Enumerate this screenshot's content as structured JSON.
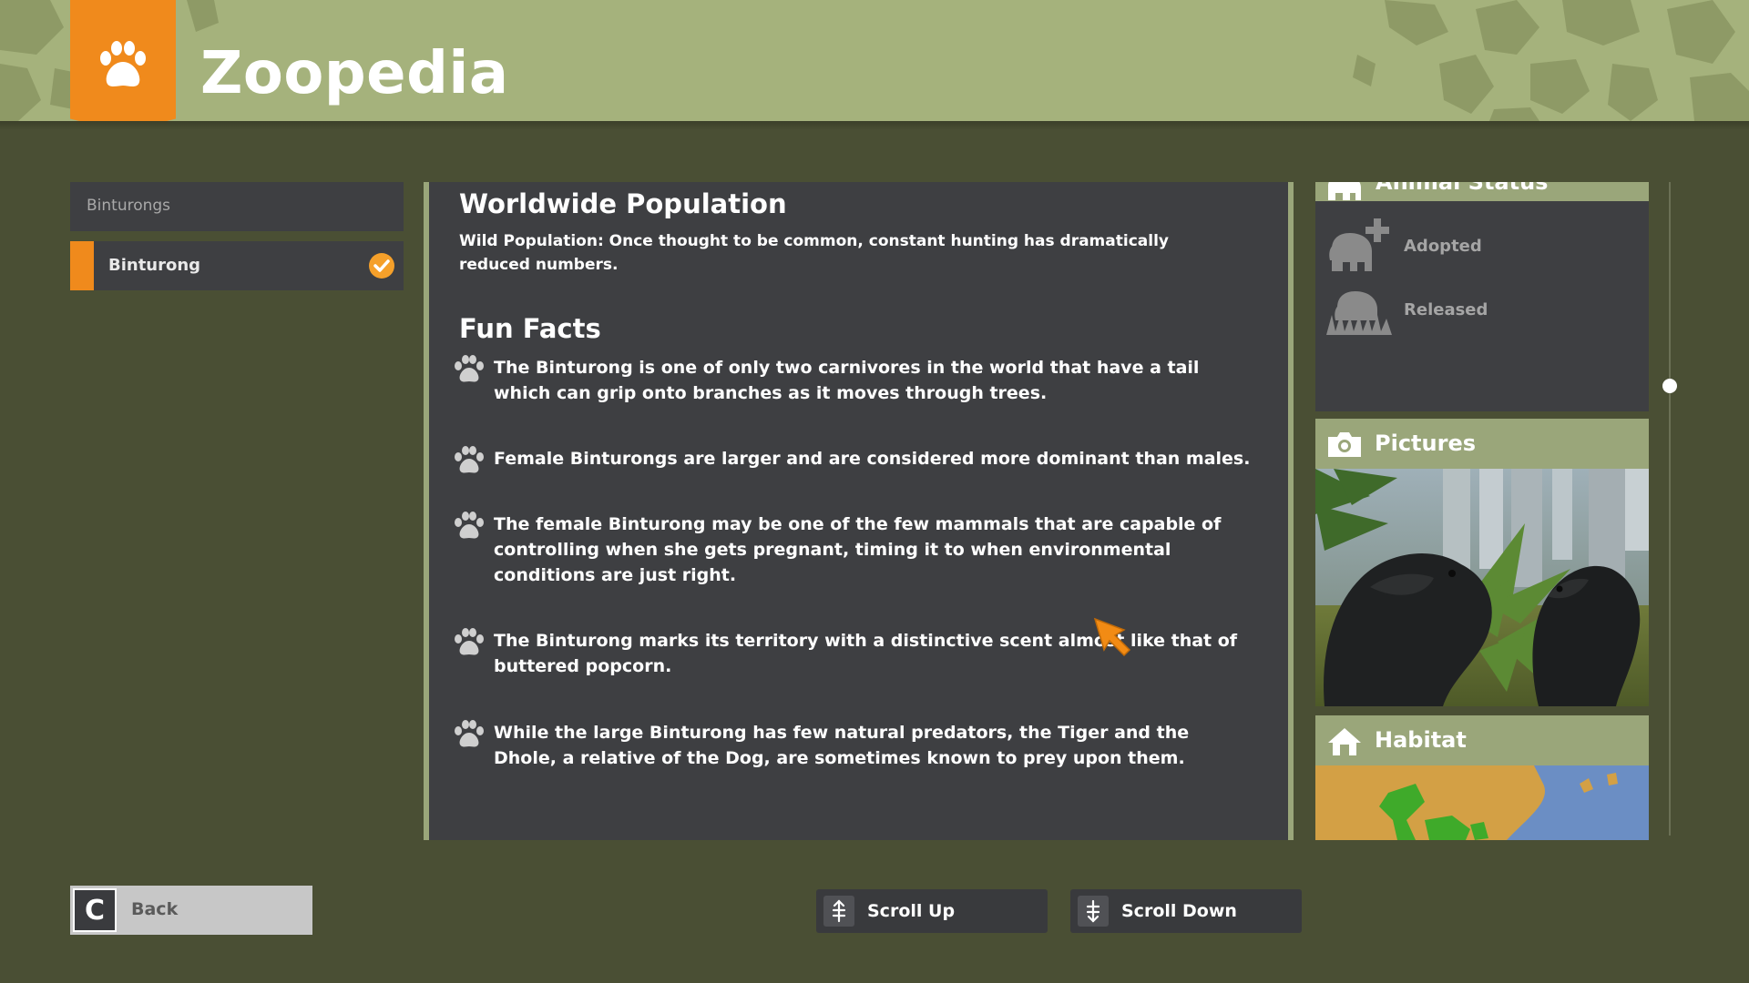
{
  "app": {
    "title": "Zoopedia"
  },
  "sidebar": {
    "category": "Binturongs",
    "items": [
      {
        "label": "Binturong",
        "checked": true
      }
    ]
  },
  "content": {
    "population": {
      "title": "Worldwide Population",
      "text": "Wild Population: Once thought to be common, constant hunting has dramatically reduced numbers."
    },
    "fun_facts": {
      "title": "Fun Facts",
      "items": [
        "The Binturong is one of only two carnivores in the world that have a tail which can grip onto branches as it moves through trees.",
        "Female Binturongs are larger and are considered more dominant than males.",
        "The female Binturong may be one of the few mammals that are capable of controlling when she gets pregnant, timing it to when environmental conditions are just right.",
        "The Binturong marks its territory with a distinctive scent almost like that of buttered popcorn.",
        "While the large Binturong has few natural predators, the Tiger and the Dhole, a relative of the Dog, are sometimes known to prey upon them."
      ]
    }
  },
  "right_panel": {
    "status": {
      "title": "Animal Status",
      "rows": [
        {
          "label": "Adopted",
          "icon": "elephant-plus-icon"
        },
        {
          "label": "Released",
          "icon": "elephant-grass-icon"
        }
      ]
    },
    "pictures": {
      "title": "Pictures",
      "icon": "camera-icon"
    },
    "habitat": {
      "title": "Habitat",
      "icon": "house-icon"
    }
  },
  "buttons": {
    "back": {
      "key": "C",
      "label": "Back"
    },
    "scroll_up": {
      "label": "Scroll Up"
    },
    "scroll_down": {
      "label": "Scroll Down"
    }
  },
  "colors": {
    "accent": "#f08a1c",
    "header_bg": "#a5b27c",
    "panel_bg": "#3e3f42",
    "page_bg": "#4a4f34"
  }
}
